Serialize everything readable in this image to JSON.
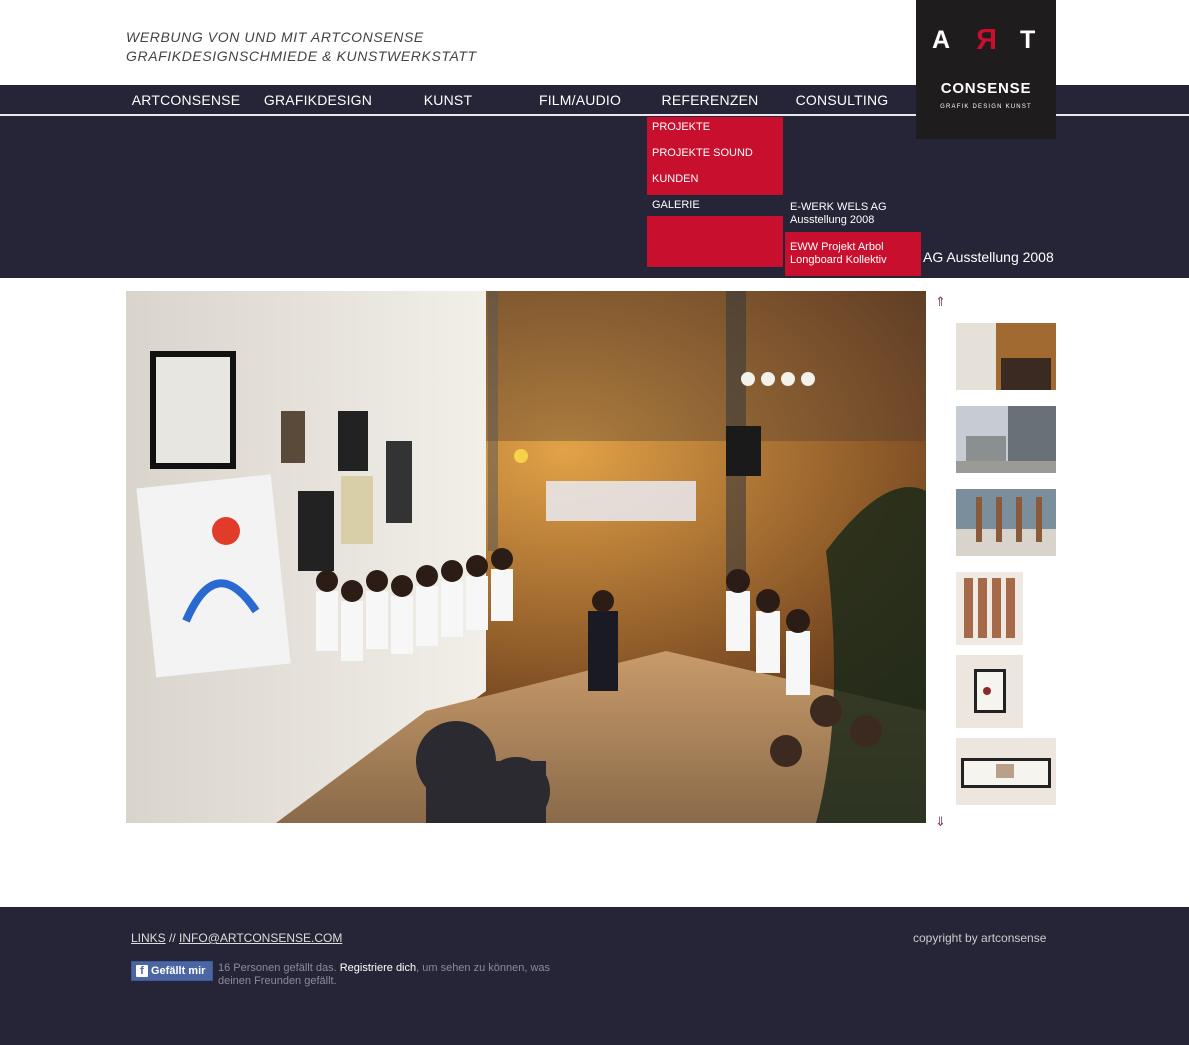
{
  "header": {
    "tagline_line1": "WERBUNG VON UND MIT ARTCONSENSE",
    "tagline_line2": "GRAFIKDESIGNSCHMIEDE & KUNSTWERKSTATT"
  },
  "logo": {
    "letter_a": "A",
    "letter_r": "R",
    "letter_t": "T",
    "name": "CONSENSE",
    "subtitle": "GRAFIK  DESIGN  KUNST"
  },
  "nav": {
    "items": [
      {
        "label": "ARTCONSENSE"
      },
      {
        "label": "GRAFIKDESIGN"
      },
      {
        "label": "KUNST"
      },
      {
        "label": "FILM/AUDIO"
      },
      {
        "label": "REFERENZEN"
      },
      {
        "label": "CONSULTING"
      }
    ]
  },
  "dropdown": {
    "items": [
      {
        "label": "PROJEKTE"
      },
      {
        "label": "PROJEKTE SOUND"
      },
      {
        "label": "KUNDEN"
      },
      {
        "label": "GALERIE"
      }
    ],
    "submenu": [
      {
        "line1": "E-WERK WELS AG",
        "line2": "Ausstellung 2008"
      },
      {
        "line1": "EWW Projekt Arbol",
        "line2": "Longboard Kollektiv"
      }
    ]
  },
  "gallery": {
    "caption": "AG Ausstellung 2008",
    "up_arrow": "⇑",
    "down_arrow": "⇓",
    "thumbnail_count": 6
  },
  "footer": {
    "links_label": "LINKS",
    "separator": " // ",
    "email_label": "INFO@ARTCONSENSE.COM",
    "copyright": "copyright by artconsense",
    "fb_button": "Gefällt mir",
    "fb_count_text": "16 Personen gefällt das. ",
    "fb_register": "Registriere dich",
    "fb_rest": ", um sehen zu können, was deinen Freunden gefällt."
  },
  "colors": {
    "nav_bg": "#252537",
    "accent_red": "#c8102e",
    "logo_bg": "#1e1c1c",
    "facebook_blue": "#4c66a4"
  }
}
